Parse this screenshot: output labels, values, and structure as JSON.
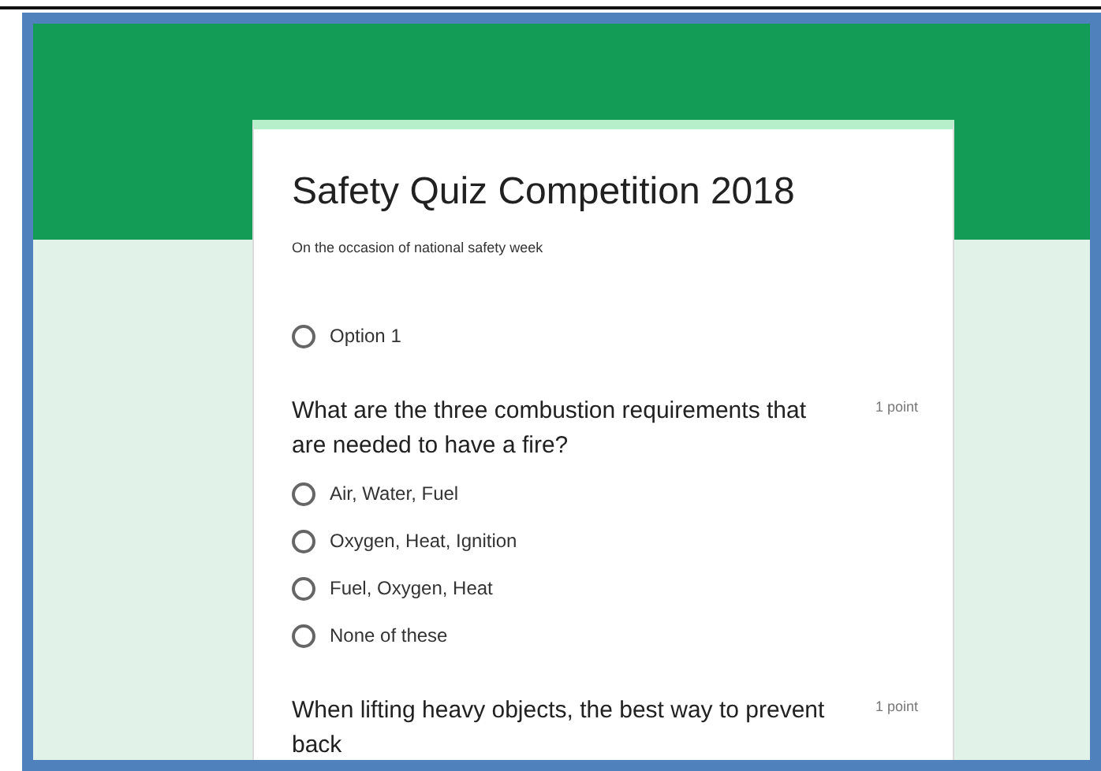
{
  "form": {
    "title": "Safety Quiz Competition 2018",
    "description": "On the occasion of national safety week"
  },
  "questions": [
    {
      "options": [
        {
          "label": "Option 1",
          "selected": false
        }
      ]
    },
    {
      "title": "What are the three combustion requirements that are needed to have a fire?",
      "points": "1 point",
      "options": [
        {
          "label": "Air, Water, Fuel",
          "selected": false
        },
        {
          "label": "Oxygen, Heat, Ignition",
          "selected": false
        },
        {
          "label": "Fuel, Oxygen, Heat",
          "selected": false
        },
        {
          "label": "None of these",
          "selected": false
        }
      ]
    },
    {
      "title": "When lifting heavy objects, the best way to prevent back",
      "points": "1 point"
    }
  ]
}
